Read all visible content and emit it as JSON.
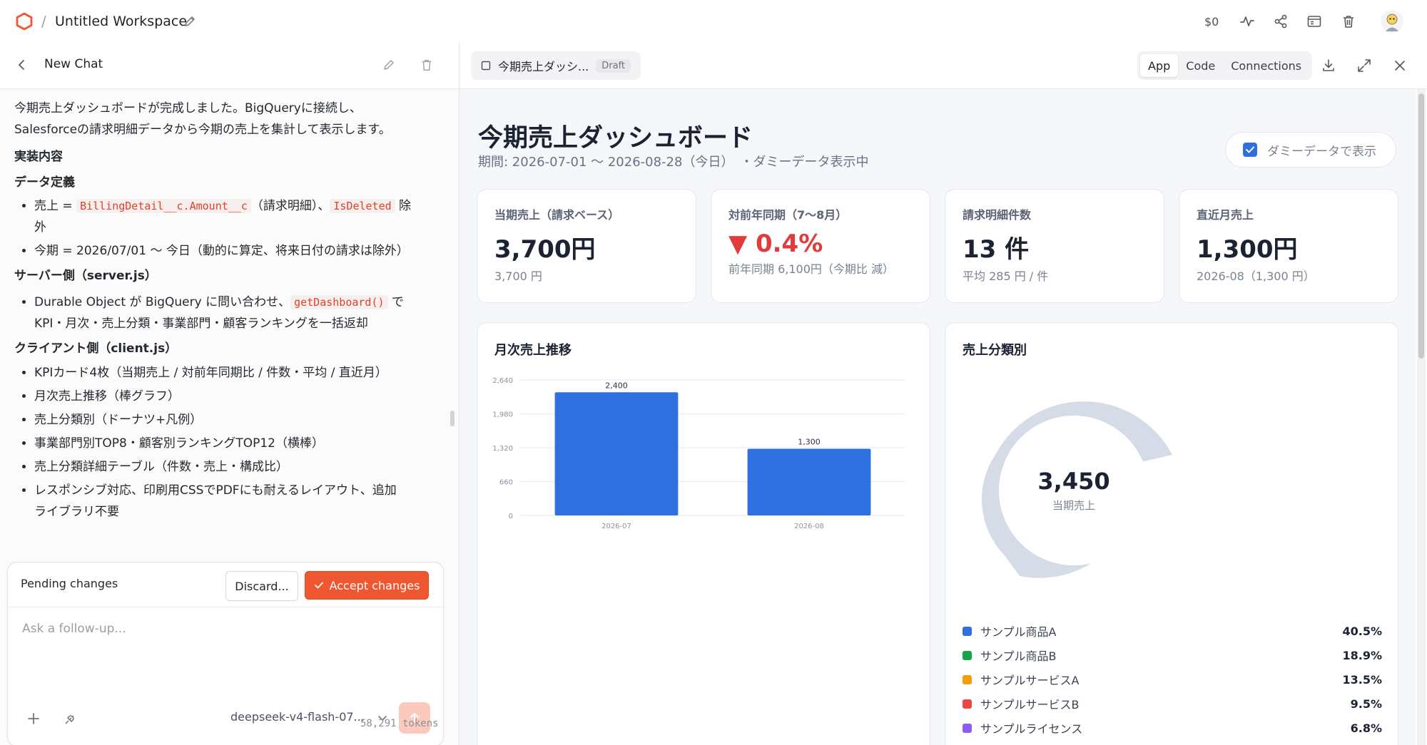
{
  "topbar": {
    "workspace_separator": "/",
    "workspace_title": "Untitled Workspace",
    "cost": "$0"
  },
  "chat": {
    "title": "New Chat",
    "intro_line1": "今期売上ダッシュボードが完成しました。BigQueryに接続し、",
    "intro_line2": "Salesforceの請求明細データから今期の売上を集計して表示します。",
    "h_impl": "実装内容",
    "h_data": "データ定義",
    "data_item1_pre": "売上 = ",
    "data_item1_code1": "BillingDetail__c.Amount__c",
    "data_item1_mid": "（請求明細）、",
    "data_item1_code2": "IsDeleted",
    "data_item1_post": " 除",
    "data_item1_wrap": "外",
    "data_item2": "今期 = 2026/07/01 〜 今日（動的に算定、将来日付の請求は除外）",
    "h_server": "サーバー側（server.js）",
    "server_item_pre": "Durable Object が BigQuery に問い合わせ、",
    "server_item_code": "getDashboard()",
    "server_item_post": " で",
    "server_item_wrap": "KPI・月次・売上分類・事業部門・顧客ランキングを一括返却",
    "h_client": "クライアント側（client.js）",
    "client_items": [
      "KPIカード4枚（当期売上 / 対前年同期比 / 件数・平均 / 直近月）",
      "月次売上推移（棒グラフ）",
      "売上分類別（ドーナツ+凡例）",
      "事業部門別TOP8・顧客別ランキングTOP12（横棒）",
      "売上分類詳細テーブル（件数・売上・構成比）"
    ],
    "client_item_last": "レスポンシブ対応、印刷用CSSでPDFにも耐えるレイアウト、追加",
    "client_item_last_wrap": "ライブラリ不要",
    "pending_label": "Pending changes",
    "discard_label": "Discard...",
    "accept_label": "Accept changes",
    "input_placeholder": "Ask a follow-up...",
    "model_name": "deepseek-v4-flash-07...",
    "tokens": "58,291 tokens"
  },
  "preview": {
    "file_name": "今期売上ダッシ...",
    "draft_badge": "Draft",
    "tabs": [
      {
        "label": "App",
        "active": true
      },
      {
        "label": "Code",
        "active": false
      },
      {
        "label": "Connections",
        "active": false
      }
    ]
  },
  "dashboard": {
    "title": "今期売上ダッシュボード",
    "period": "期間: 2026-07-01 〜 2026-08-28（今日）　・ダミーデータ表示中",
    "dummy_toggle_label": "ダミーデータで表示",
    "dummy_toggle_checked": true,
    "kpis": [
      {
        "label": "当期売上（請求ベース）",
        "value": "3,700円",
        "sub": "3,700 円"
      },
      {
        "label": "対前年同期（7〜8月）",
        "value": "▼ 0.4%",
        "sub": "前年同期 6,100円（今期比 減）",
        "color": "#e23b3b"
      },
      {
        "label": "請求明細件数",
        "value": "13 件",
        "sub": "平均 285 円 / 件"
      },
      {
        "label": "直近月売上",
        "value": "1,300円",
        "sub": "2026-08（1,300 円）"
      }
    ],
    "monthly_title": "月次売上推移",
    "category_title": "売上分類別",
    "donut_center_value": "3,450",
    "donut_center_label": "当期売上",
    "legend": [
      {
        "name": "サンプル商品A",
        "pct": "40.5%",
        "color": "#2f6fe0"
      },
      {
        "name": "サンプル商品B",
        "pct": "18.9%",
        "color": "#16a34a"
      },
      {
        "name": "サンプルサービスA",
        "pct": "13.5%",
        "color": "#f59e0b"
      },
      {
        "name": "サンプルサービスB",
        "pct": "9.5%",
        "color": "#ef4444"
      },
      {
        "name": "サンプルライセンス",
        "pct": "6.8%",
        "color": "#8b5cf6"
      }
    ]
  },
  "chart_data": {
    "type": "bar",
    "categories": [
      "2026-07",
      "2026-08"
    ],
    "values": [
      2400,
      1300
    ],
    "value_labels": [
      "2,400",
      "1,300"
    ],
    "yticks": [
      0,
      660,
      1320,
      1980,
      2640
    ],
    "ytick_labels": [
      "0",
      "660",
      "1,320",
      "1,980",
      "2,640"
    ],
    "ylim": [
      0,
      2640
    ],
    "bar_color": "#2f6fe0",
    "title": "月次売上推移",
    "grid": true,
    "xlabel": "",
    "ylabel": ""
  },
  "colors": {
    "accent": "#f0562f",
    "chart_blue": "#2f6fe0",
    "donut_track": "#d5dce7",
    "negative": "#e23b3b"
  }
}
